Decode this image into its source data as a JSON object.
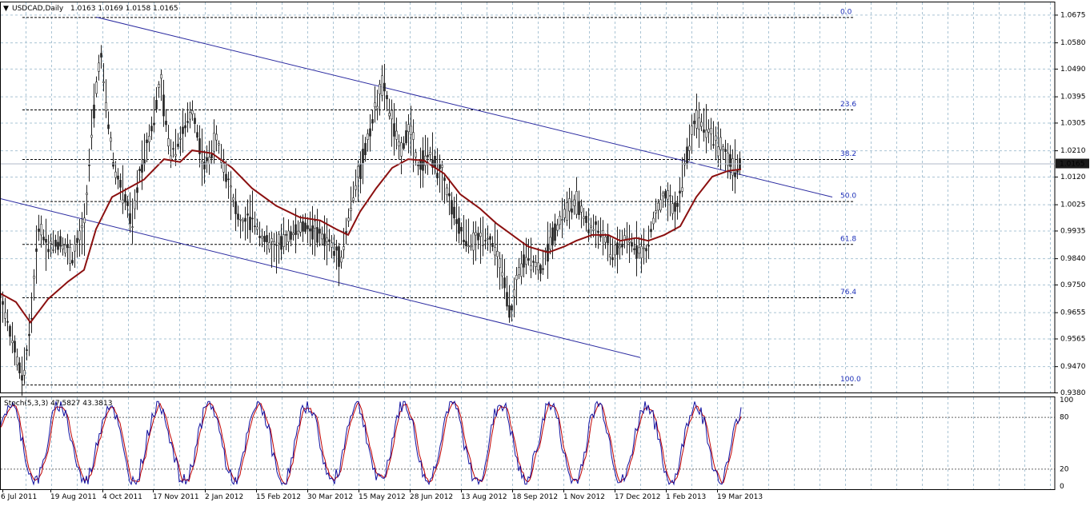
{
  "chart_data": {
    "type": "candlestick",
    "header": {
      "symbol": "USDCAD,Daily",
      "ohlc": "1.0163 1.0169 1.0158 1.0165"
    },
    "current_price_label": "1.0165",
    "price_axis": {
      "ylim": [
        0.938,
        1.072
      ],
      "tick_labels": [
        "1.0675",
        "1.0580",
        "1.0490",
        "1.0395",
        "1.0305",
        "1.0210",
        "1.0120",
        "1.0025",
        "0.9935",
        "0.9840",
        "0.9750",
        "0.9655",
        "0.9565",
        "0.9470",
        "0.9380"
      ]
    },
    "x_labels": [
      "6 Jul 2011",
      "19 Aug 2011",
      "4 Oct 2011",
      "17 Nov 2011",
      "2 Jan 2012",
      "15 Feb 2012",
      "30 Mar 2012",
      "15 May 2012",
      "28 Jun 2012",
      "13 Aug 2012",
      "18 Sep 2012",
      "1 Nov 2012",
      "17 Dec 2012",
      "1 Feb 2013",
      "19 Mar 2013"
    ],
    "fib_levels": [
      {
        "label": "0.0",
        "price": 1.0667
      },
      {
        "label": "23.6",
        "price": 1.035
      },
      {
        "label": "38.2",
        "price": 1.018
      },
      {
        "label": "50.0",
        "price": 1.0036
      },
      {
        "label": "61.8",
        "price": 0.9889
      },
      {
        "label": "76.4",
        "price": 0.9706
      },
      {
        "label": "100.0",
        "price": 0.9407
      }
    ],
    "channel_lines": [
      {
        "name": "",
        "from": {
          "bar": 120,
          "price": 1.0667
        },
        "to": {
          "bar": 1040,
          "price": 1.005
        }
      },
      {
        "name": "",
        "from": {
          "bar": 0,
          "price": 1.0045
        },
        "to": {
          "bar": 800,
          "price": 0.95
        }
      }
    ],
    "price_path": [
      [
        0,
        0.972
      ],
      [
        20,
        0.95
      ],
      [
        28,
        0.942
      ],
      [
        38,
        0.962
      ],
      [
        48,
        0.995
      ],
      [
        60,
        0.988
      ],
      [
        75,
        0.99
      ],
      [
        90,
        0.984
      ],
      [
        105,
        0.995
      ],
      [
        115,
        1.03
      ],
      [
        125,
        1.055
      ],
      [
        133,
        1.035
      ],
      [
        142,
        1.015
      ],
      [
        155,
        1.005
      ],
      [
        165,
        0.996
      ],
      [
        175,
        1.015
      ],
      [
        190,
        1.03
      ],
      [
        200,
        1.045
      ],
      [
        212,
        1.02
      ],
      [
        225,
        1.025
      ],
      [
        240,
        1.035
      ],
      [
        255,
        1.015
      ],
      [
        270,
        1.025
      ],
      [
        285,
        1.01
      ],
      [
        300,
        0.995
      ],
      [
        315,
        0.998
      ],
      [
        330,
        0.99
      ],
      [
        345,
        0.987
      ],
      [
        360,
        0.992
      ],
      [
        380,
        0.995
      ],
      [
        395,
        0.993
      ],
      [
        410,
        0.99
      ],
      [
        425,
        0.983
      ],
      [
        440,
        1.005
      ],
      [
        455,
        1.02
      ],
      [
        468,
        1.035
      ],
      [
        478,
        1.044
      ],
      [
        490,
        1.03
      ],
      [
        500,
        1.02
      ],
      [
        512,
        1.03
      ],
      [
        522,
        1.015
      ],
      [
        535,
        1.02
      ],
      [
        548,
        1.015
      ],
      [
        560,
        1.005
      ],
      [
        575,
        0.993
      ],
      [
        590,
        0.989
      ],
      [
        605,
        0.992
      ],
      [
        618,
        0.988
      ],
      [
        630,
        0.975
      ],
      [
        638,
        0.964
      ],
      [
        648,
        0.98
      ],
      [
        660,
        0.985
      ],
      [
        675,
        0.98
      ],
      [
        690,
        0.992
      ],
      [
        705,
        1.0
      ],
      [
        720,
        1.003
      ],
      [
        735,
        0.995
      ],
      [
        750,
        0.993
      ],
      [
        765,
        0.985
      ],
      [
        780,
        0.99
      ],
      [
        795,
        0.988
      ],
      [
        808,
        0.986
      ],
      [
        818,
        1.0
      ],
      [
        830,
        1.005
      ],
      [
        845,
        1.0
      ],
      [
        858,
        1.02
      ],
      [
        868,
        1.032
      ],
      [
        880,
        1.03
      ],
      [
        892,
        1.025
      ],
      [
        905,
        1.02
      ],
      [
        915,
        1.015
      ],
      [
        926,
        1.0165
      ]
    ],
    "ma_path": [
      [
        0,
        0.972
      ],
      [
        20,
        0.969
      ],
      [
        38,
        0.962
      ],
      [
        60,
        0.97
      ],
      [
        85,
        0.976
      ],
      [
        105,
        0.98
      ],
      [
        120,
        0.994
      ],
      [
        140,
        1.005
      ],
      [
        160,
        1.008
      ],
      [
        180,
        1.011
      ],
      [
        205,
        1.018
      ],
      [
        225,
        1.017
      ],
      [
        240,
        1.021
      ],
      [
        265,
        1.02
      ],
      [
        290,
        1.015
      ],
      [
        315,
        1.008
      ],
      [
        345,
        1.002
      ],
      [
        375,
        0.998
      ],
      [
        400,
        0.997
      ],
      [
        420,
        0.994
      ],
      [
        435,
        0.992
      ],
      [
        450,
        1.0
      ],
      [
        470,
        1.008
      ],
      [
        490,
        1.015
      ],
      [
        510,
        1.018
      ],
      [
        530,
        1.0175
      ],
      [
        555,
        1.013
      ],
      [
        575,
        1.006
      ],
      [
        600,
        1.001
      ],
      [
        620,
        0.996
      ],
      [
        640,
        0.992
      ],
      [
        660,
        0.988
      ],
      [
        685,
        0.986
      ],
      [
        705,
        0.988
      ],
      [
        720,
        0.99
      ],
      [
        740,
        0.992
      ],
      [
        760,
        0.992
      ],
      [
        775,
        0.99
      ],
      [
        795,
        0.991
      ],
      [
        810,
        0.99
      ],
      [
        830,
        0.992
      ],
      [
        850,
        0.995
      ],
      [
        870,
        1.005
      ],
      [
        890,
        1.012
      ],
      [
        910,
        1.014
      ],
      [
        926,
        1.0145
      ]
    ],
    "stochastic": {
      "label": "Stoch(5,3,3) 47.5827 43.3813",
      "ylim": [
        0,
        100
      ],
      "levels": [
        80,
        20
      ],
      "tick_labels": [
        "100",
        "80",
        "20",
        "0"
      ],
      "main_color": "#1010a0",
      "signal_color": "#c00000"
    },
    "colors": {
      "candle": "#222222",
      "ma": "#8b1010",
      "channel": "#2a2aa0",
      "grid": "#aac4d4",
      "fib": "#000000",
      "fib_label": "#1c2fb8",
      "price_tag_bg": "#1a1a1a",
      "price_tag_text": "#ffffff"
    },
    "grid": true
  }
}
